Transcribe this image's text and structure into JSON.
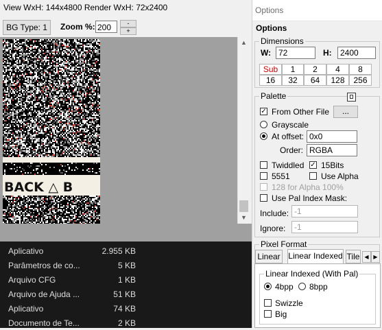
{
  "viewer": {
    "title": "View WxH: 144x4800 Render WxH: 72x2400",
    "bg_type_label": "BG Type: 1",
    "zoom_label": "Zoom %:",
    "zoom_value": "200",
    "spin_up": "-",
    "spin_down": "+",
    "preview_overlay_text": "BACK △ B"
  },
  "files": [
    {
      "name": "Aplicativo",
      "size": "2.955 KB"
    },
    {
      "name": "Parâmetros de co...",
      "size": "5 KB"
    },
    {
      "name": "Arquivo CFG",
      "size": "1 KB"
    },
    {
      "name": "Arquivo de Ajuda ...",
      "size": "51 KB"
    },
    {
      "name": "Aplicativo",
      "size": "74 KB"
    },
    {
      "name": "Documento de Te...",
      "size": "2 KB"
    }
  ],
  "options": {
    "window_title": "Options",
    "heading": "Options",
    "dimensions": {
      "label": "Dimensions",
      "w_label": "W:",
      "w_value": "72",
      "h_label": "H:",
      "h_value": "2400",
      "row1": [
        "Sub",
        "1",
        "2",
        "4",
        "8"
      ],
      "row2": [
        "16",
        "32",
        "64",
        "128",
        "256"
      ]
    },
    "palette": {
      "label": "Palette",
      "from_other_file_label": "From Other File",
      "from_other_file_checked": true,
      "browse_label": "...",
      "grayscale_label": "Grayscale",
      "at_offset_label": "At offset:",
      "offset_value": "0x0",
      "order_label": "Order:",
      "order_value": "RGBA",
      "twiddled_label": "Twiddled",
      "bits15_label": "15Bits",
      "bits15_checked": true,
      "c5551_label": "5551",
      "use_alpha_label": "Use Alpha",
      "alpha128_label": "128 for Alpha 100%",
      "use_pal_index_mask_label": "Use Pal Index Mask:",
      "include_label": "Include:",
      "include_value": "-1",
      "ignore_label": "Ignore:",
      "ignore_value": "-1"
    },
    "pixel_format": {
      "label": "Pixel Format",
      "tabs": [
        "Linear",
        "Linear Indexed",
        "Tile"
      ],
      "active_tab": "Linear Indexed",
      "sub_label": "Linear Indexed (With Pal)",
      "bpp4_label": "4bpp",
      "bpp8_label": "8bpp",
      "swizzle_label": "Swizzle",
      "big_label": "Big"
    }
  }
}
